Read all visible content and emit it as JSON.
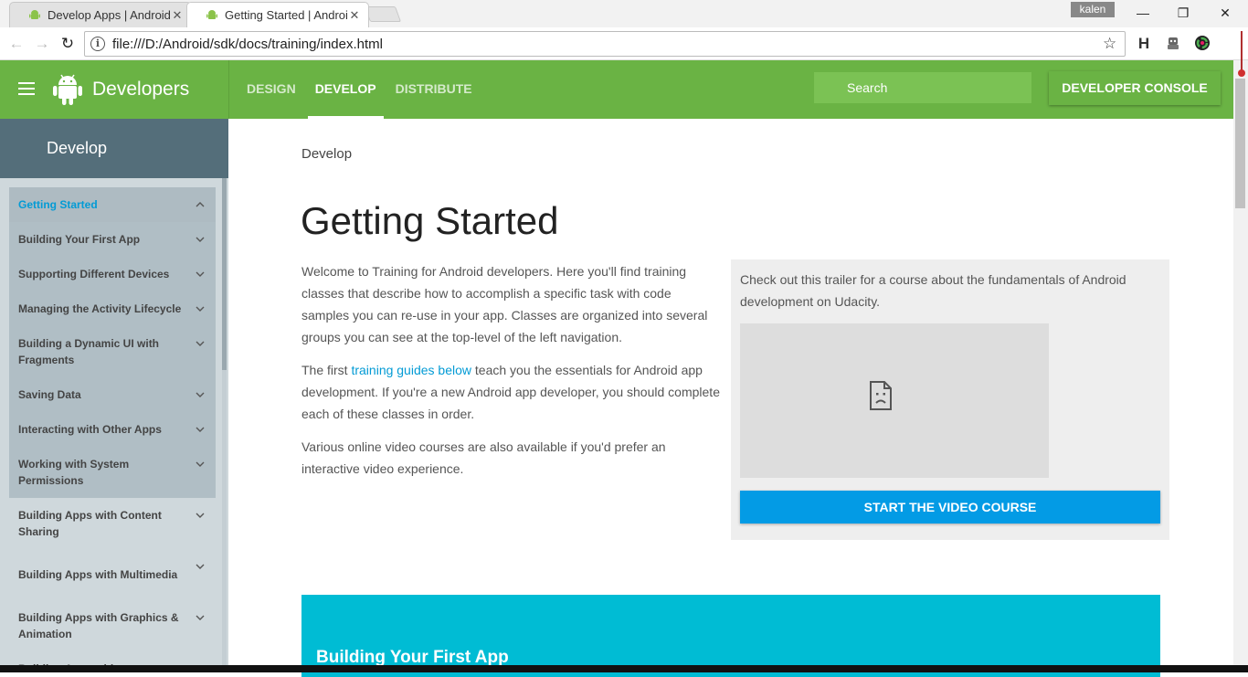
{
  "browser": {
    "tabs": [
      {
        "title": "Develop Apps | Android",
        "active": false
      },
      {
        "title": "Getting Started | Android",
        "active": true
      }
    ],
    "profile": "kalen",
    "url": "file:///D:/Android/sdk/docs/training/index.html",
    "window_buttons": {
      "minimize": "—",
      "restore": "❐",
      "close": "✕"
    },
    "extension_h": "H"
  },
  "header": {
    "brand": "Developers",
    "nav": [
      {
        "label": "DESIGN",
        "active": false
      },
      {
        "label": "DEVELOP",
        "active": true
      },
      {
        "label": "DISTRIBUTE",
        "active": false
      }
    ],
    "search_placeholder": "Search",
    "console_button": "DEVELOPER CONSOLE"
  },
  "sidebar": {
    "title": "Develop",
    "items": [
      {
        "label": "Getting Started",
        "active": true
      },
      {
        "label": "Building Your First App"
      },
      {
        "label": "Supporting Different Devices"
      },
      {
        "label": "Managing the Activity Lifecycle"
      },
      {
        "label": "Building a Dynamic UI with Fragments"
      },
      {
        "label": "Saving Data"
      },
      {
        "label": "Interacting with Other Apps"
      },
      {
        "label": "Working with System Permissions"
      },
      {
        "label": "Building Apps with Content Sharing"
      },
      {
        "label": "Building Apps with Multimedia"
      },
      {
        "label": "Building Apps with Graphics & Animation"
      },
      {
        "label": "Building Apps with"
      }
    ]
  },
  "main": {
    "breadcrumb": "Develop",
    "title": "Getting Started",
    "paragraph1": "Welcome to Training for Android developers. Here you'll find training classes that describe how to accomplish a specific task with code samples you can re-use in your app. Classes are organized into several groups you can see at the top-level of the left navigation.",
    "paragraph2_before": "The first ",
    "paragraph2_link": "training guides below",
    "paragraph2_after": " teach you the essentials for Android app development. If you're a new Android app developer, you should complete each of these classes in order.",
    "paragraph3": "Various online video courses are also available if you'd prefer an interactive video experience.",
    "video_caption": "Check out this trailer for a course about the fundamentals of Android development on Udacity.",
    "video_button": "START THE VIDEO COURSE",
    "card_title": "Building Your First App"
  },
  "colors": {
    "header_green": "#6ab344",
    "sidebar_head": "#546e7a",
    "sidebar_bg": "#cfd8dc",
    "link_blue": "#039bd5",
    "button_blue": "#039be5",
    "card_cyan": "#00bcd4"
  }
}
